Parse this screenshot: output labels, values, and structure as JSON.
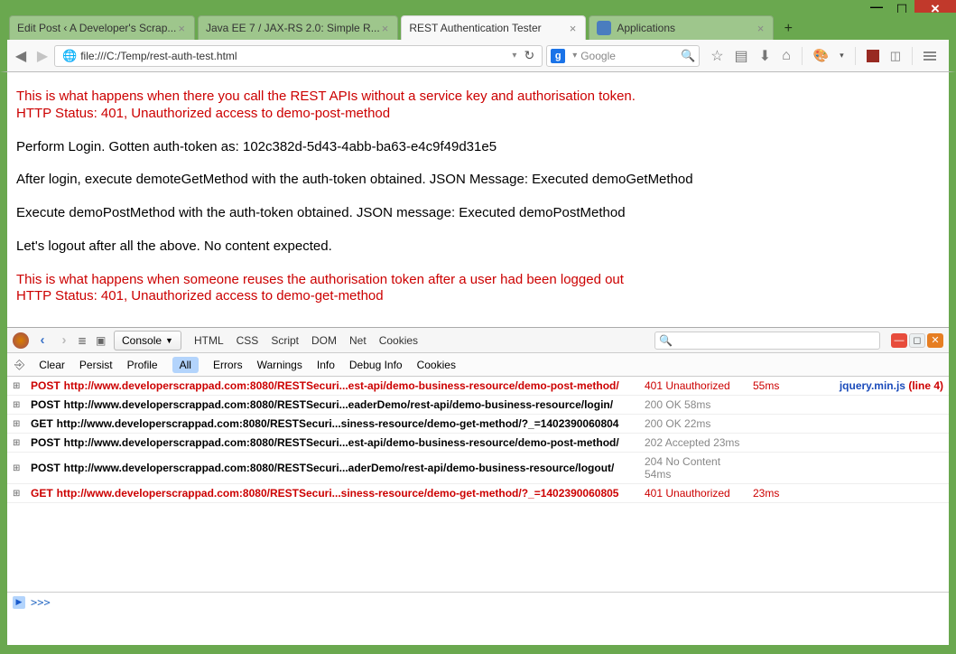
{
  "window": {
    "min": "—",
    "max": "☐",
    "close": "×"
  },
  "tabs": [
    {
      "title": "Edit Post ‹ A Developer's Scrap..."
    },
    {
      "title": "Java EE 7 / JAX-RS 2.0: Simple R..."
    },
    {
      "title": "REST Authentication Tester"
    },
    {
      "title": "Applications",
      "icon": true
    }
  ],
  "url": {
    "value": "file:///C:/Temp/rest-auth-test.html"
  },
  "search": {
    "placeholder": "Google",
    "engine": "g"
  },
  "page": {
    "red1a": "This is what happens when there you call the REST APIs without a service key and authorisation token.",
    "red1b": "HTTP Status: 401, Unauthorized access to demo-post-method",
    "p2": "Perform Login. Gotten auth-token as: 102c382d-5d43-4abb-ba63-e4c9f49d31e5",
    "p3": "After login, execute demoteGetMethod with the auth-token obtained. JSON Message: Executed demoGetMethod",
    "p4": "Execute demoPostMethod with the auth-token obtained. JSON message: Executed demoPostMethod",
    "p5": "Let's logout after all the above. No content expected.",
    "red2a": "This is what happens when someone reuses the authorisation token after a user had been logged out",
    "red2b": "HTTP Status: 401, Unauthorized access to demo-get-method"
  },
  "devtools": {
    "main_panels": {
      "console": "Console",
      "html": "HTML",
      "css": "CSS",
      "script": "Script",
      "dom": "DOM",
      "net": "Net",
      "cookies": "Cookies"
    },
    "sub": {
      "clear": "Clear",
      "persist": "Persist",
      "profile": "Profile",
      "all": "All",
      "errors": "Errors",
      "warnings": "Warnings",
      "info": "Info",
      "debug": "Debug Info",
      "cookies": "Cookies"
    },
    "rows": [
      {
        "err": true,
        "method": "POST",
        "url": "http://www.developerscrappad.com:8080/RESTSecuri...est-api/demo-business-resource/demo-post-method/",
        "status": "401 Unauthorized",
        "time": "55ms",
        "source": "jquery.min.js",
        "line": "(line 4)"
      },
      {
        "err": false,
        "method": "POST",
        "url": "http://www.developerscrappad.com:8080/RESTSecuri...eaderDemo/rest-api/demo-business-resource/login/",
        "status": "200 OK",
        "time": "58ms"
      },
      {
        "err": false,
        "method": "GET",
        "url": "http://www.developerscrappad.com:8080/RESTSecuri...siness-resource/demo-get-method/?_=1402390060804",
        "status": "200 OK",
        "time": "22ms"
      },
      {
        "err": false,
        "method": "POST",
        "url": "http://www.developerscrappad.com:8080/RESTSecuri...est-api/demo-business-resource/demo-post-method/",
        "status": "202 Accepted",
        "time": "23ms"
      },
      {
        "err": false,
        "method": "POST",
        "url": "http://www.developerscrappad.com:8080/RESTSecuri...aderDemo/rest-api/demo-business-resource/logout/",
        "status": "204 No Content",
        "time": "54ms"
      },
      {
        "err": true,
        "method": "GET",
        "url": "http://www.developerscrappad.com:8080/RESTSecuri...siness-resource/demo-get-method/?_=1402390060805",
        "status": "401 Unauthorized",
        "time": "23ms"
      }
    ],
    "prompt": ">>>"
  }
}
